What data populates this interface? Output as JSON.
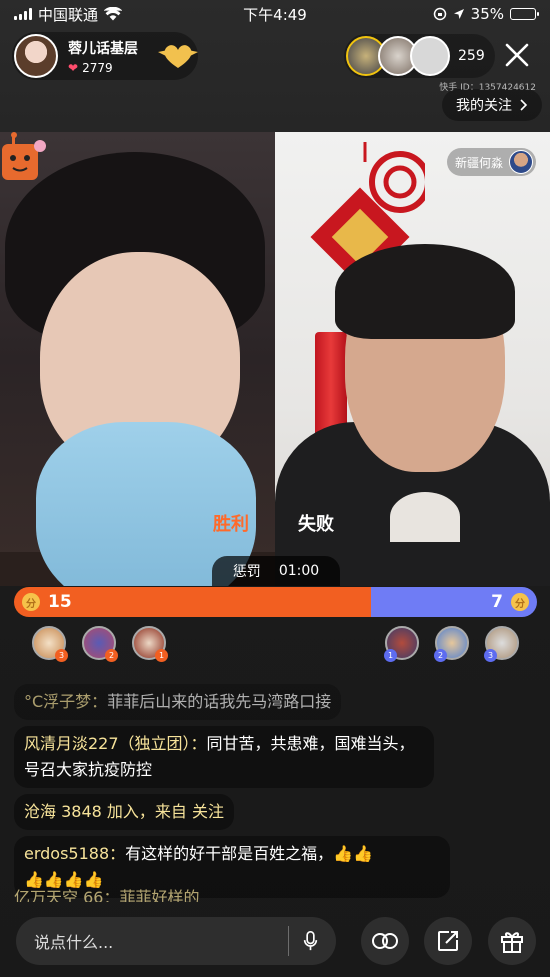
{
  "status_bar": {
    "carrier": "中国联通",
    "time": "下午4:49",
    "battery": "35%"
  },
  "anchor": {
    "name": "蓉儿话基层",
    "likes": "2779"
  },
  "viewers": {
    "count": "259"
  },
  "kuaishou_id": "快手 ID：1357424612",
  "my_follow": "我的关注",
  "peer_host": {
    "name": "新疆何淼"
  },
  "pk": {
    "result_left": "胜利",
    "result_right": "失败",
    "penalty_label": "惩罚",
    "penalty_time": "01:00",
    "score_left": "15",
    "score_right": "7",
    "score_left_value": 15,
    "score_right_value": 7,
    "left_color": "#f25f21",
    "right_color": "#6f7cf5",
    "left_ranks": [
      "3",
      "2",
      "1"
    ],
    "right_ranks": [
      "1",
      "2",
      "3"
    ]
  },
  "comments": [
    {
      "nick": "°C浮子梦：",
      "text": "菲菲后山来的话我先马湾路口接",
      "faded": true
    },
    {
      "nick": "风清月淡227（独立团）：",
      "text": "同甘苦，共患难，国难当头，号召大家抗疫防控"
    },
    {
      "nick": "沧海 3848 加入，来自 关注",
      "text": ""
    },
    {
      "nick": "erdos5188：",
      "text": "有这样的好干部是百姓之福，",
      "thumbs_inline": "👍👍",
      "thumbs_line2": "👍👍👍👍"
    }
  ],
  "partial_comment": "亿万天空 66：菲菲好样的",
  "input": {
    "placeholder": "说点什么..."
  },
  "icons": [
    "signal-icon",
    "wifi-icon",
    "location-icon",
    "battery-icon",
    "heart-icon",
    "close-icon",
    "chevron-right-icon",
    "coin-icon",
    "mic-icon",
    "pk-link-icon",
    "share-icon",
    "gift-icon"
  ]
}
